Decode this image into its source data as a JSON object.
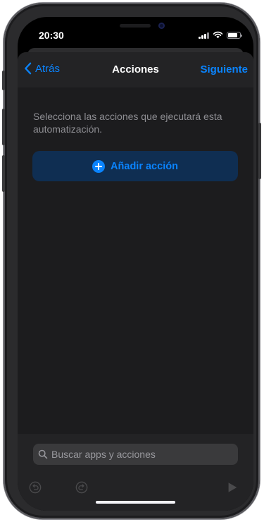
{
  "status_bar": {
    "time": "20:30",
    "icons": [
      "cellular-signal-icon",
      "wifi-icon",
      "battery-icon"
    ],
    "battery_level": 0.8
  },
  "nav": {
    "back_label": "Atrás",
    "title": "Acciones",
    "next_label": "Siguiente"
  },
  "content": {
    "description": "Selecciona las acciones que ejecutará esta automatización.",
    "add_action_label": "Añadir acción"
  },
  "bottom": {
    "search_placeholder": "Buscar apps y acciones",
    "toolbar_icons": [
      "undo-icon",
      "redo-icon",
      "play-icon"
    ]
  },
  "colors": {
    "accent": "#0a84ff",
    "background": "#1c1c1e",
    "nav_background": "#232325",
    "add_button_background": "#0f2e52",
    "secondary_text": "#8e8e93",
    "disabled_icon": "#4a4a4c"
  }
}
